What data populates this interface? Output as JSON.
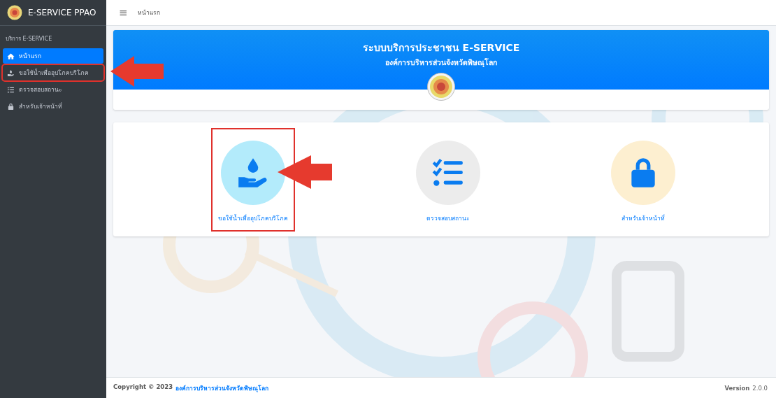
{
  "brand": {
    "title": "E-SERVICE PPAO"
  },
  "sidebar": {
    "section": "บริการ E-SERVICE",
    "items": [
      {
        "label": "หน้าแรก",
        "kind": "home",
        "selected": true,
        "highlighted": false
      },
      {
        "label": "ขอใช้น้ำเพื่ออุปโภคบริโภค",
        "kind": "water",
        "selected": false,
        "highlighted": true
      },
      {
        "label": "ตรวจสอบสถานะ",
        "kind": "list",
        "selected": false,
        "highlighted": false
      },
      {
        "label": "สำหรับเจ้าหน้าที่",
        "kind": "lock",
        "selected": false,
        "highlighted": false
      }
    ]
  },
  "topbar": {
    "menu_icon": "≡",
    "breadcrumb": "หน้าแรก"
  },
  "banner": {
    "title": "ระบบบริการประชาชน E-SERVICE",
    "subtitle": "องค์การบริหารส่วนจังหวัดพิษณุโลก"
  },
  "services": [
    {
      "label": "ขอใช้น้ำเพื่ออุปโภคบริโภค",
      "kind": "water",
      "color": "#b3ebfb",
      "highlighted": true
    },
    {
      "label": "ตรวจสอบสถานะ",
      "kind": "list",
      "color": "#ececec",
      "highlighted": false
    },
    {
      "label": "สำหรับเจ้าหน้าที่",
      "kind": "lock",
      "color": "#fdefd0",
      "highlighted": false
    }
  ],
  "footer": {
    "copyright": "Copyright © 2023",
    "organization": "องค์การบริหารส่วนจังหวัดพิษณุโลก",
    "version_label": "Version",
    "version": "2.0.0"
  }
}
